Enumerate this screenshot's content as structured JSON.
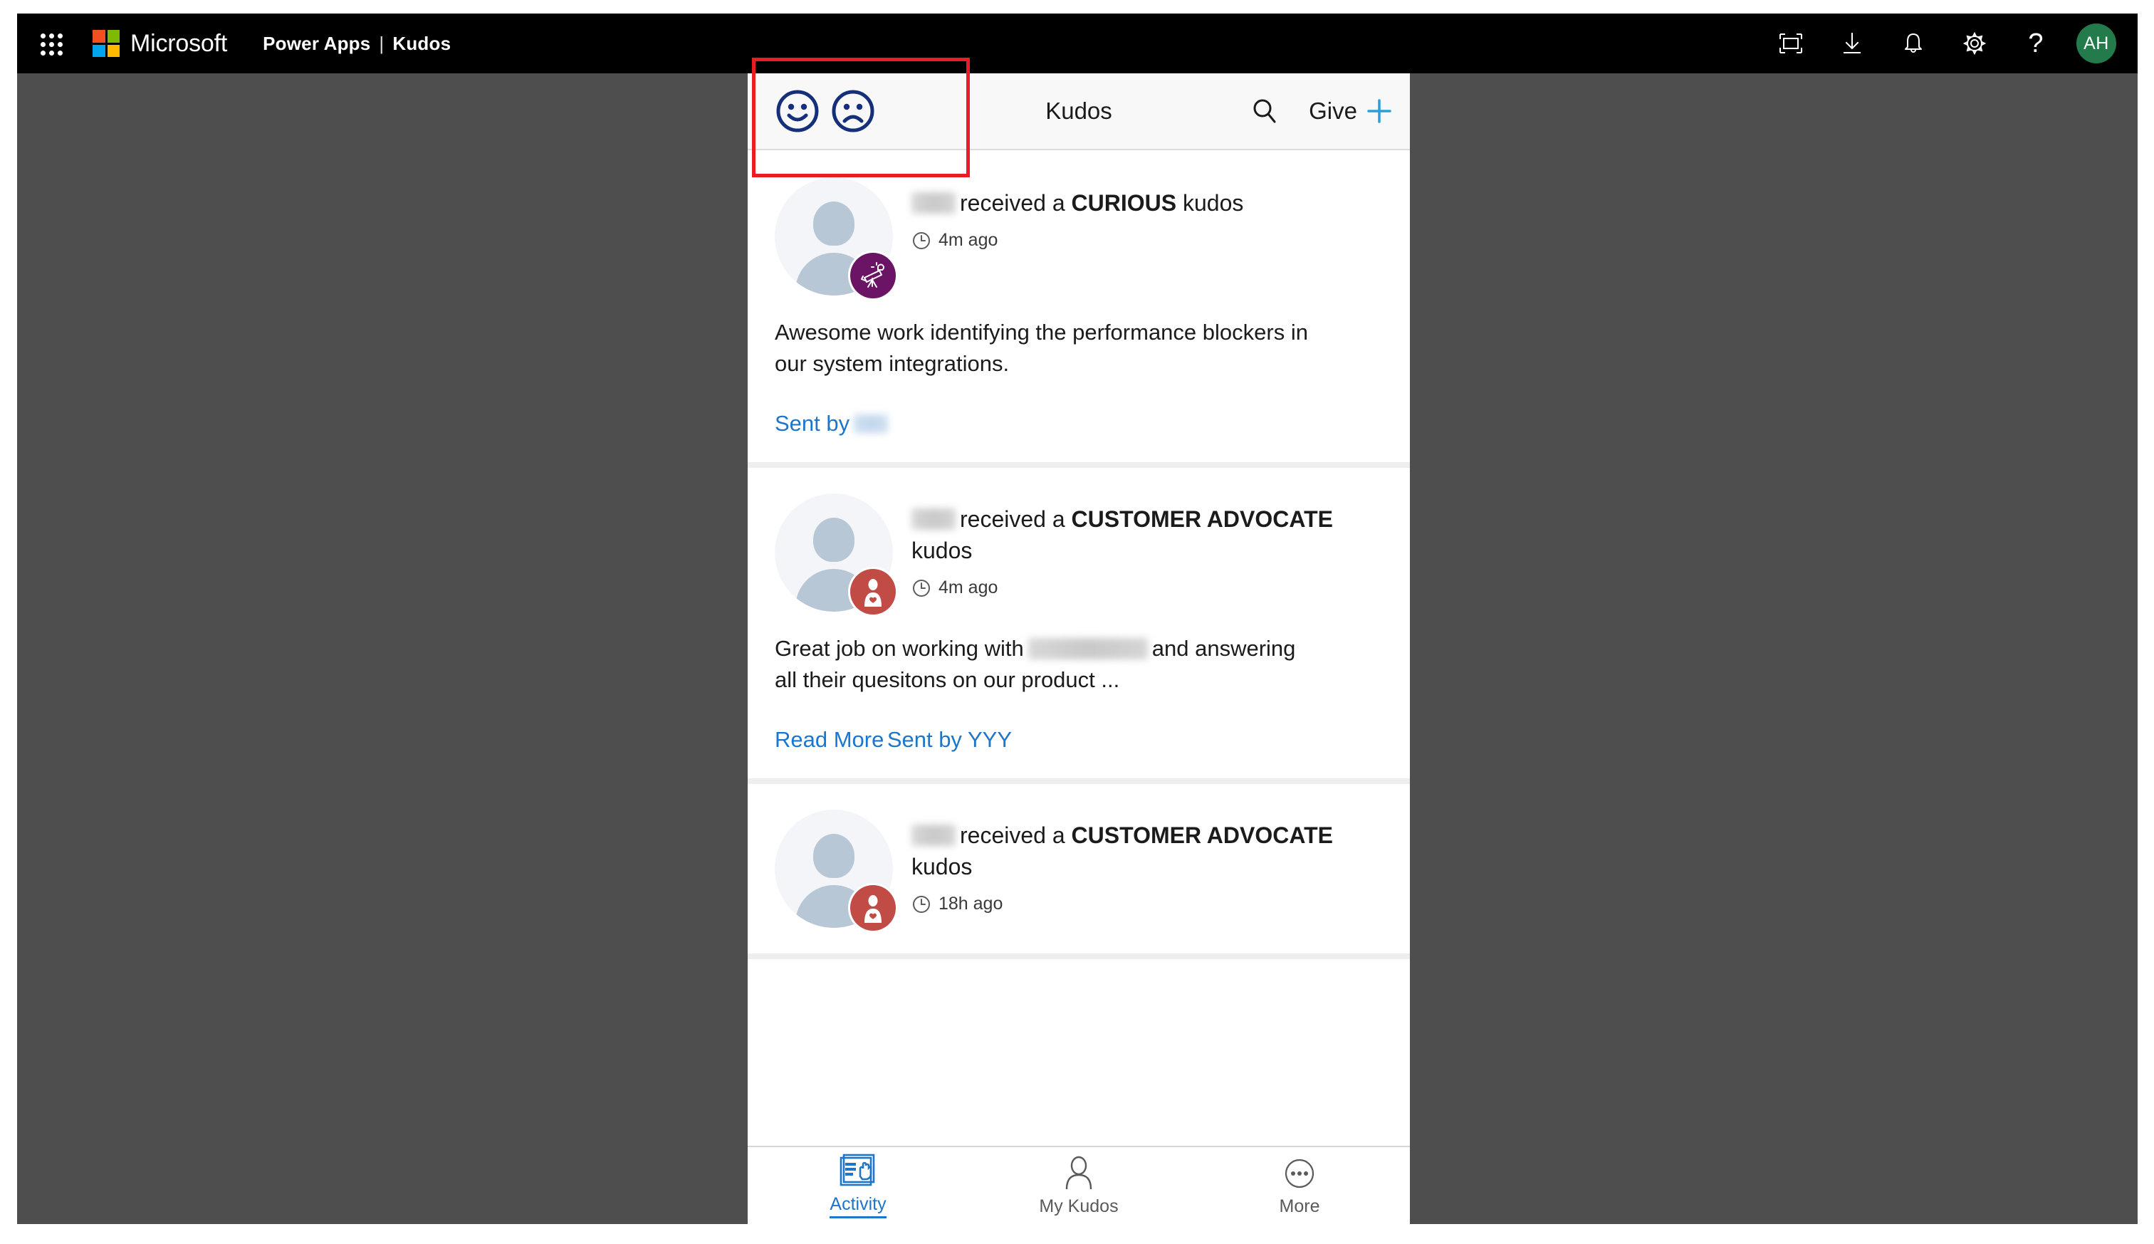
{
  "suite_bar": {
    "waffle_icon": "app-launcher-icon",
    "brand": "Microsoft",
    "app_label": "Power Apps",
    "divider": "|",
    "app_sub_label": "Kudos",
    "actions": [
      {
        "name": "fit-to-screen-icon",
        "label": "Fit to screen"
      },
      {
        "name": "download-icon",
        "label": "Download"
      },
      {
        "name": "notifications-bell-icon",
        "label": "Notifications"
      },
      {
        "name": "settings-gear-icon",
        "label": "Settings"
      },
      {
        "name": "help-question-icon",
        "label": "?"
      }
    ],
    "avatar": {
      "initials": "AH",
      "color": "#237B4B"
    }
  },
  "app": {
    "title": "Kudos",
    "mood_icons": [
      {
        "name": "happy-face-icon",
        "mood": "happy",
        "color": "#152f7a"
      },
      {
        "name": "sad-face-icon",
        "mood": "sad",
        "color": "#152f7a"
      }
    ],
    "search_icon": "search-icon",
    "give_label": "Give",
    "give_plus_icon": "plus-icon",
    "give_plus_color": "#2a9ddb"
  },
  "feed": {
    "cards": [
      {
        "recipient": "",
        "head_prefix": "received a ",
        "kudos_type": "CURIOUS",
        "head_suffix": " kudos",
        "time": "4m ago",
        "badge": {
          "name": "telescope-badge-icon",
          "color": "#6B1466"
        },
        "message": "Awesome work identifying the performance blockers in our system integrations.",
        "read_more": null,
        "sent_by_label": "Sent by",
        "sent_by_name": "",
        "sent_by_blurred": true
      },
      {
        "recipient": "",
        "head_prefix": "received a ",
        "kudos_type": "CUSTOMER ADVOCATE",
        "head_suffix": " kudos",
        "time": "4m ago",
        "badge": {
          "name": "customer-advocate-badge-icon",
          "color": "#C14B45"
        },
        "message_before": "Great job on working with",
        "message_after": "and answering all their quesitons on our product ...",
        "read_more": "Read More",
        "sent_by_label": "Sent by YYY",
        "sent_by_blurred": false
      },
      {
        "recipient": "",
        "head_prefix": "received a ",
        "kudos_type": "CUSTOMER ADVOCATE",
        "head_suffix": " kudos",
        "time": "18h ago",
        "badge": {
          "name": "customer-advocate-badge-icon",
          "color": "#C14B45"
        }
      }
    ]
  },
  "bottom_nav": {
    "items": [
      {
        "name": "nav-activity",
        "label": "Activity",
        "icon": "activity-pages-icon",
        "active": true
      },
      {
        "name": "nav-my-kudos",
        "label": "My Kudos",
        "icon": "person-icon",
        "active": false
      },
      {
        "name": "nav-more",
        "label": "More",
        "icon": "ellipsis-circle-icon",
        "active": false
      }
    ]
  },
  "annotation": {
    "name": "highlight-box",
    "color": "#ec1c24"
  }
}
